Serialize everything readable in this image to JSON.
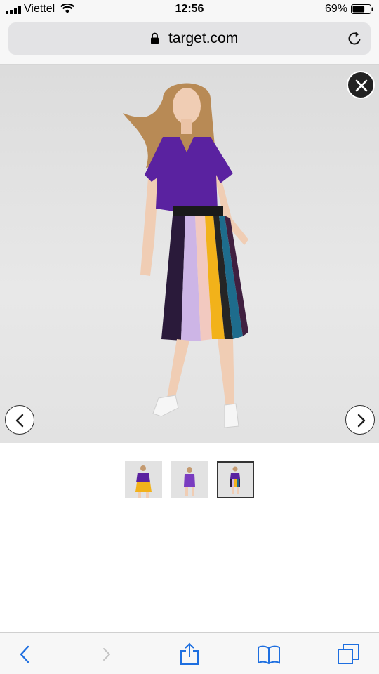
{
  "status_bar": {
    "carrier": "Viettel",
    "time": "12:56",
    "battery": "69%",
    "battery_level": 0.69,
    "icons": [
      "signal-icon",
      "wifi-icon",
      "battery-icon"
    ]
  },
  "browser": {
    "url": "target.com",
    "icons": [
      "lock-icon",
      "reload-icon"
    ]
  },
  "viewer": {
    "image": "model-photo",
    "selected_index": 3,
    "thumbnail_count": 3,
    "icons": [
      "close-icon",
      "chevron-left-icon",
      "chevron-right-icon"
    ],
    "colors": {
      "top": "#5a22a0",
      "skirt_stripes": [
        "#2a1a3a",
        "#cdb5e6",
        "#f2c9c0",
        "#f2b21a",
        "#252525",
        "#1e6c8c",
        "#402040"
      ]
    }
  },
  "toolbar": {
    "icons": [
      "back-icon",
      "forward-icon",
      "share-icon",
      "bookmarks-icon",
      "tabs-icon"
    ],
    "accent": "#1e6fe0"
  }
}
